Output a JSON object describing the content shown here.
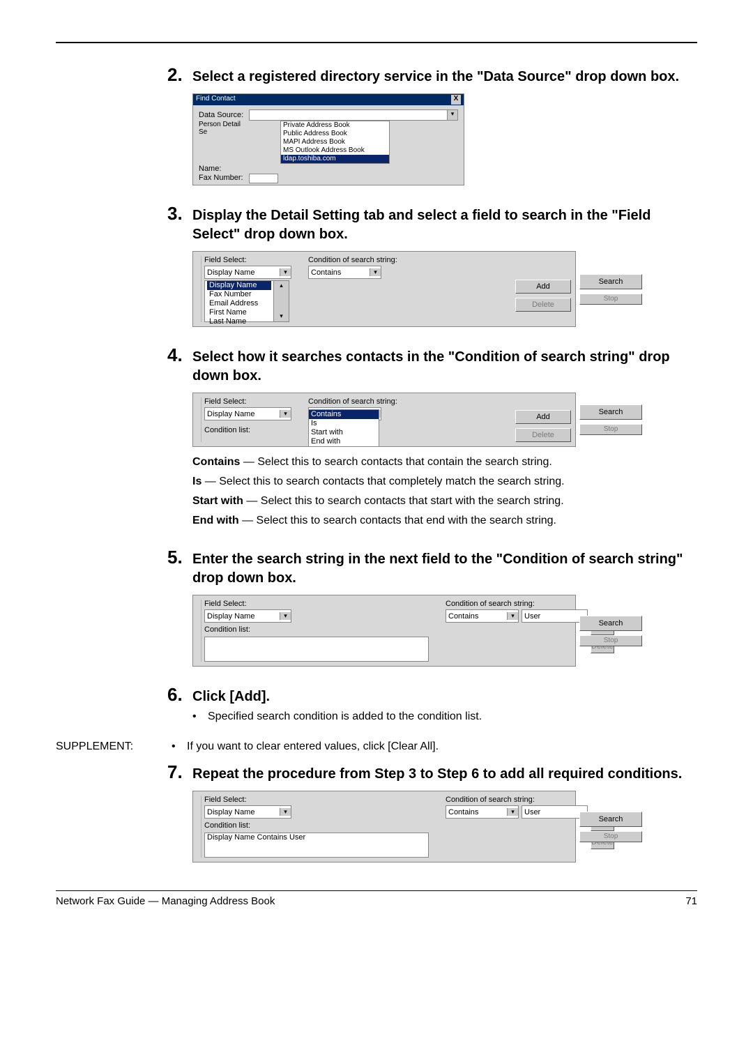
{
  "steps": {
    "s2": {
      "num": "2.",
      "title": "Select a registered directory service in the \"Data Source\" drop down box."
    },
    "s3": {
      "num": "3.",
      "title": "Display the Detail Setting tab and select a field to search in the \"Field Select\" drop down box."
    },
    "s4": {
      "num": "4.",
      "title": "Select how it searches contacts in the \"Condition of search string\" drop down box."
    },
    "s5": {
      "num": "5.",
      "title": "Enter the search string in the next field to the \"Condition of search string\" drop down box."
    },
    "s6": {
      "num": "6.",
      "title": "Click [Add]."
    },
    "s6b": "Specified search condition is added to the condition list.",
    "s7": {
      "num": "7.",
      "title": "Repeat the procedure from Step 3 to Step 6 to add all required conditions."
    }
  },
  "defs": {
    "contains": "Contains",
    "containsTxt": " — Select this to search contacts that contain the search string.",
    "is": "Is",
    "isTxt": " — Select this to search contacts that completely match the search string.",
    "start": "Start with",
    "startTxt": " — Select this to search contacts that start with the search string.",
    "end": "End with",
    "endTxt": " — Select this to search contacts that end with the search string."
  },
  "supp": {
    "label": "SUPPLEMENT:",
    "text": "If you want to clear entered values, click [Clear All]."
  },
  "footer": {
    "left": "Network Fax Guide — Managing Address Book",
    "right": "71"
  },
  "figA": {
    "title": "Find Contact",
    "close": "X",
    "dataSource": "Data Source:",
    "tabs": "Person    Detail Se",
    "name": "Name:",
    "fax": "Fax Number:",
    "opts": [
      "Private Address Book",
      "Public Address Book",
      "MAPI Address Book",
      "MS Outlook Address Book",
      "ldap.toshiba.com"
    ]
  },
  "common": {
    "fieldSelect": "Field Select:",
    "condSearch": "Condition of search string:",
    "conditionList": "Condition list:",
    "displayName": "Display Name",
    "contains": "Contains",
    "add": "Add",
    "delete": "Delete",
    "search": "Search",
    "stop": "Stop",
    "user": "User"
  },
  "fig3": {
    "list": [
      "Display Name",
      "Fax Number",
      "Email Address",
      "First Name",
      "Last Name"
    ]
  },
  "fig4": {
    "list": [
      "Contains",
      "Is",
      "Start with",
      "End with"
    ]
  },
  "fig7": {
    "cond": "Display Name Contains User"
  }
}
